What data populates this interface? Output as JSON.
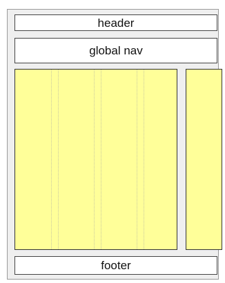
{
  "layout": {
    "header_label": "header",
    "nav_label": "global nav",
    "footer_label": "footer"
  },
  "colors": {
    "content_fill": "#ffff99",
    "box_fill": "#ffffff",
    "frame_fill": "#efefef",
    "border": "#444444"
  }
}
